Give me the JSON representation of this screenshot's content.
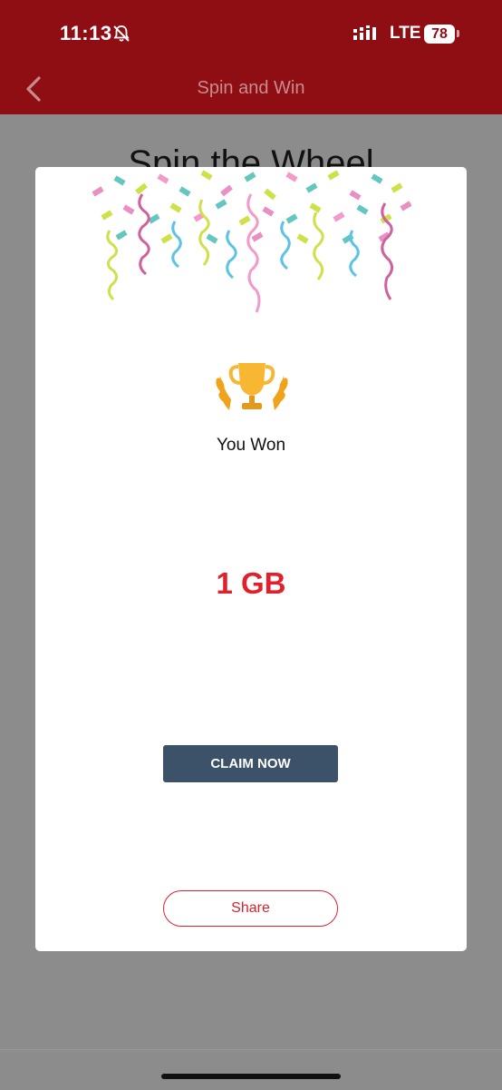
{
  "status_bar": {
    "time": "11:13",
    "network": "LTE",
    "battery": "78",
    "icons": [
      "bell-slash-icon",
      "signal-icon"
    ]
  },
  "nav": {
    "title": "Spin and Win",
    "back_icon": "chevron-left-icon"
  },
  "page": {
    "heading": "Spin the Wheel"
  },
  "modal": {
    "trophy_icon": "trophy-icon",
    "you_won": "You Won",
    "prize": "1 GB",
    "claim_label": "CLAIM NOW",
    "share_label": "Share"
  },
  "colors": {
    "header_bg": "#8e0e14",
    "prize_red": "#e0202a",
    "claim_bg": "#3b5268",
    "share_border": "#d8232c",
    "confetti": [
      "#e88fc4",
      "#63c7c0",
      "#cfe04a",
      "#f29ac9",
      "#5cc3e6",
      "#d1619e"
    ]
  }
}
